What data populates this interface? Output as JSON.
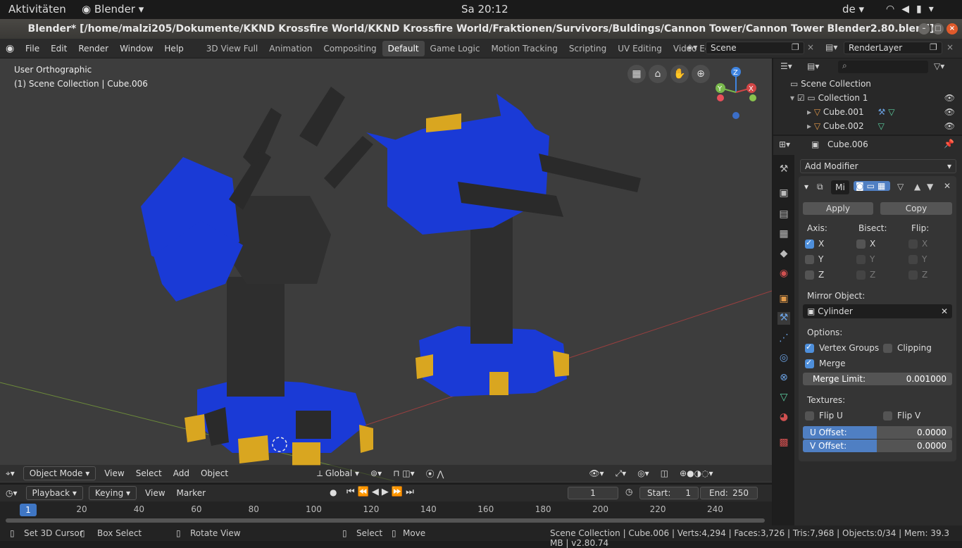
{
  "os": {
    "activities": "Aktivitäten",
    "app": "Blender",
    "clock": "Sa 20:12",
    "lang": "de"
  },
  "window": {
    "title": "Blender* [/home/malzi205/Dokumente/KKND Krossfire World/KKND Krossfire World/Fraktionen/Survivors/Buldings/Cannon Tower/Cannon Tower Blender2.80.blend]"
  },
  "menu": [
    "File",
    "Edit",
    "Render",
    "Window",
    "Help"
  ],
  "workspaces": [
    {
      "label": "3D View Full",
      "active": false
    },
    {
      "label": "Animation",
      "active": false
    },
    {
      "label": "Compositing",
      "active": false
    },
    {
      "label": "Default",
      "active": true
    },
    {
      "label": "Game Logic",
      "active": false
    },
    {
      "label": "Motion Tracking",
      "active": false
    },
    {
      "label": "Scripting",
      "active": false
    },
    {
      "label": "UV Editing",
      "active": false
    },
    {
      "label": "Video Editing",
      "active": false
    }
  ],
  "scene": {
    "name": "Scene",
    "render_layer": "RenderLayer"
  },
  "viewport": {
    "view_name": "User Orthographic",
    "collection_info": "(1) Scene Collection | Cube.006",
    "gizmo": {
      "x": "X",
      "y": "Y",
      "z": "Z"
    },
    "header": {
      "mode": "Object Mode",
      "view": "View",
      "select": "Select",
      "add": "Add",
      "object": "Object",
      "orientation": "Global"
    }
  },
  "timeline": {
    "playback": "Playback",
    "keying": "Keying",
    "view": "View",
    "marker": "Marker",
    "current_frame": "1",
    "start_label": "Start:",
    "start": "1",
    "end_label": "End:",
    "end": "250",
    "ticks": [
      "20",
      "40",
      "60",
      "80",
      "100",
      "120",
      "140",
      "160",
      "180",
      "200",
      "220",
      "240"
    ],
    "tick_values": [
      20,
      40,
      60,
      80,
      100,
      120,
      140,
      160,
      180,
      200,
      220,
      240
    ]
  },
  "outliner": {
    "root": "Scene Collection",
    "collection": "Collection 1",
    "items": [
      "Cube.001",
      "Cube.002"
    ]
  },
  "properties": {
    "object": "Cube.006",
    "add_modifier": "Add Modifier",
    "modifier_name": "Mi",
    "apply": "Apply",
    "copy": "Copy",
    "axis_label": "Axis:",
    "bisect_label": "Bisect:",
    "flip_label": "Flip:",
    "axis": {
      "x": "X",
      "y": "Y",
      "z": "Z"
    },
    "mirror_object_label": "Mirror Object:",
    "mirror_object": "Cylinder",
    "options_label": "Options:",
    "vertex_groups": "Vertex Groups",
    "clipping": "Clipping",
    "merge": "Merge",
    "merge_limit_label": "Merge Limit:",
    "merge_limit": "0.001000",
    "textures_label": "Textures:",
    "flip_u": "Flip U",
    "flip_v": "Flip V",
    "u_offset_label": "U Offset:",
    "u_offset": "0.0000",
    "v_offset_label": "V Offset:",
    "v_offset": "0.0000"
  },
  "status": {
    "set_cursor": "Set 3D Cursor",
    "box_select": "Box Select",
    "rotate": "Rotate View",
    "select": "Select",
    "move": "Move",
    "info": "Scene Collection | Cube.006 | Verts:4,294 | Faces:3,726 | Tris:7,968 | Objects:0/34 | Mem: 39.3 MB | v2.80.74"
  },
  "colors": {
    "accent": "#4f7fc3",
    "tower_blue": "#1a3ad6",
    "tower_dark": "#2e2e2e",
    "tower_gold": "#d9a620"
  }
}
